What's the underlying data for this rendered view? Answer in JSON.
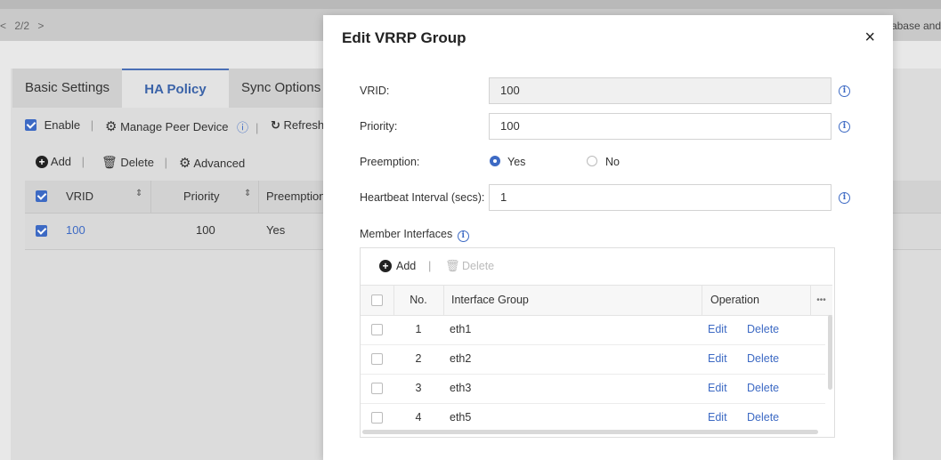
{
  "background": {
    "pager": {
      "prev": "<",
      "text": "2/2",
      "next": ">"
    },
    "right_snippet": "abase and",
    "tabs": [
      "Basic Settings",
      "HA Policy",
      "Sync Options"
    ],
    "toolbar1": {
      "enable": "Enable",
      "manage_peer": "Manage Peer Device",
      "refresh": "Refresh"
    },
    "toolbar2": {
      "add": "Add",
      "delete": "Delete",
      "advanced": "Advanced"
    },
    "table": {
      "headers": [
        "VRID",
        "Priority",
        "Preemption"
      ],
      "rows": [
        {
          "vrid": "100",
          "priority": "100",
          "preemption": "Yes"
        }
      ]
    }
  },
  "modal": {
    "title": "Edit VRRP Group",
    "close": "×",
    "fields": {
      "vrid": {
        "label": "VRID:",
        "value": "100"
      },
      "priority": {
        "label": "Priority:",
        "value": "100"
      },
      "preemption": {
        "label": "Preemption:",
        "yes": "Yes",
        "no": "No",
        "selected": "Yes"
      },
      "heartbeat": {
        "label": "Heartbeat Interval (secs):",
        "value": "1"
      }
    },
    "member_label": "Member Interfaces",
    "member_toolbar": {
      "add": "Add",
      "delete": "Delete"
    },
    "member_table": {
      "headers": {
        "no": "No.",
        "group": "Interface Group",
        "operation": "Operation",
        "more": "•••"
      },
      "rows": [
        {
          "no": "1",
          "group": "eth1",
          "edit": "Edit",
          "delete": "Delete"
        },
        {
          "no": "2",
          "group": "eth2",
          "edit": "Edit",
          "delete": "Delete"
        },
        {
          "no": "3",
          "group": "eth3",
          "edit": "Edit",
          "delete": "Delete"
        },
        {
          "no": "4",
          "group": "eth5",
          "edit": "Edit",
          "delete": "Delete"
        }
      ]
    }
  },
  "colors": {
    "accent": "#3d6ac4",
    "overlay": "#c9c9c9"
  }
}
